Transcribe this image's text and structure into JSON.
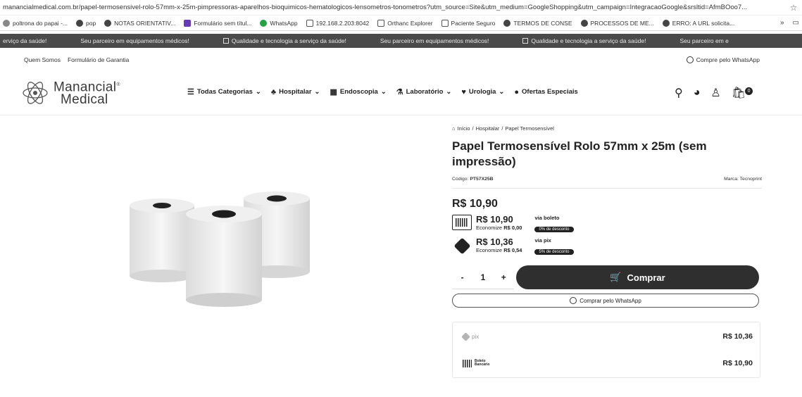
{
  "browser": {
    "url": "manancialmedical.com.br/papel-termosensivel-rolo-57mm-x-25m-pimpressoras-aparelhos-bioquimicos-hematologicos-lensometros-tonometros?utm_source=Site&utm_medium=GoogleShopping&utm_campaign=IntegracaoGoogle&srsltid=AfmBOoo7...",
    "bookmarks": [
      {
        "label": "poltrona do papai -...",
        "icon": "bookmark-icon"
      },
      {
        "label": "pop",
        "icon": "globe-icon"
      },
      {
        "label": "NOTAS ORIENTATIV...",
        "icon": "globe-icon"
      },
      {
        "label": "Formulário sem títul...",
        "icon": "forms-icon"
      },
      {
        "label": "WhatsApp",
        "icon": "whatsapp-icon"
      },
      {
        "label": "192.168.2.203:8042",
        "icon": "server-icon"
      },
      {
        "label": "Orthanc Explorer",
        "icon": "server-icon"
      },
      {
        "label": "Paciente Seguro",
        "icon": "server-icon"
      },
      {
        "label": "TERMOS DE CONSE",
        "icon": "globe-icon"
      },
      {
        "label": "PROCESSOS DE ME...",
        "icon": "globe-icon"
      },
      {
        "label": "ERRO: A URL solicita...",
        "icon": "globe-icon"
      }
    ]
  },
  "marquee": [
    "erviço da saúde!",
    "Seu parceiro em equipamentos médicos!",
    "Qualidade e tecnologia a serviço da saúde!",
    "Seu parceiro em equipamentos médicos!",
    "Qualidade e tecnologia a serviço da saúde!",
    "Seu parceiro em e"
  ],
  "toplinks": {
    "about": "Quem Somos",
    "warranty": "Formulário de Garantia",
    "whatsapp": "Compre pelo WhatsApp"
  },
  "header": {
    "logo_line1": "Manancial",
    "logo_line2": "Medical",
    "nav": [
      {
        "label": "Todas Categorias",
        "icon": "menu-icon"
      },
      {
        "label": "Hospitalar",
        "icon": "hospital-icon"
      },
      {
        "label": "Endoscopia",
        "icon": "endoscope-icon"
      },
      {
        "label": "Laboratório",
        "icon": "microscope-icon"
      },
      {
        "label": "Urologia",
        "icon": "urology-icon"
      },
      {
        "label": "Ofertas Especiais",
        "icon": "offer-icon"
      }
    ],
    "cart_count": "0"
  },
  "product": {
    "breadcrumb": [
      "Início",
      "Hospitalar",
      "Papel Termosensível"
    ],
    "title": "Papel Termosensível Rolo 57mm x 25m (sem impressão)",
    "code_label": "Código:",
    "code": "PT57X25B",
    "brand_label": "Marca:",
    "brand": "Tecnoprint",
    "price": "R$ 10,90",
    "payments": [
      {
        "value": "R$ 10,90",
        "save_label": "Economize",
        "save": "R$ 0,00",
        "via": "via boleto",
        "badge": "0% de desconto"
      },
      {
        "value": "R$ 10,36",
        "save_label": "Economize",
        "save": "R$ 0,54",
        "via": "via pix",
        "badge": "5% de desconto"
      }
    ],
    "qty_minus": "-",
    "qty": "1",
    "qty_plus": "+",
    "buy_label": "Comprar",
    "wa_label": "Comprar pelo WhatsApp",
    "summary": [
      {
        "method": "pix",
        "value": "R$ 10,36"
      },
      {
        "method_line1": "Boleto",
        "method_line2": "Bancário",
        "value": "R$ 10,90"
      }
    ]
  }
}
